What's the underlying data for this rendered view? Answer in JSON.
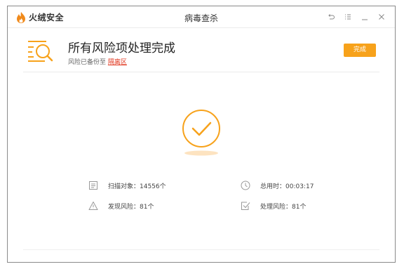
{
  "app": {
    "name": "火绒安全",
    "window_title": "病毒查杀"
  },
  "window_controls": [
    "restore-icon",
    "menu-icon",
    "minimize-icon",
    "close-icon"
  ],
  "header": {
    "title": "所有风险项处理完成",
    "backup_prefix": "风险已备份至",
    "quarantine_link": "隔离区",
    "done_button": "完成"
  },
  "stats": {
    "scanned": "扫描对象：14556个",
    "elapsed": "总用时：00:03:17",
    "found": "发现风险：81个",
    "handled": "处理风险：81个"
  },
  "colors": {
    "accent": "#f7a21b",
    "link": "#e0341c"
  }
}
